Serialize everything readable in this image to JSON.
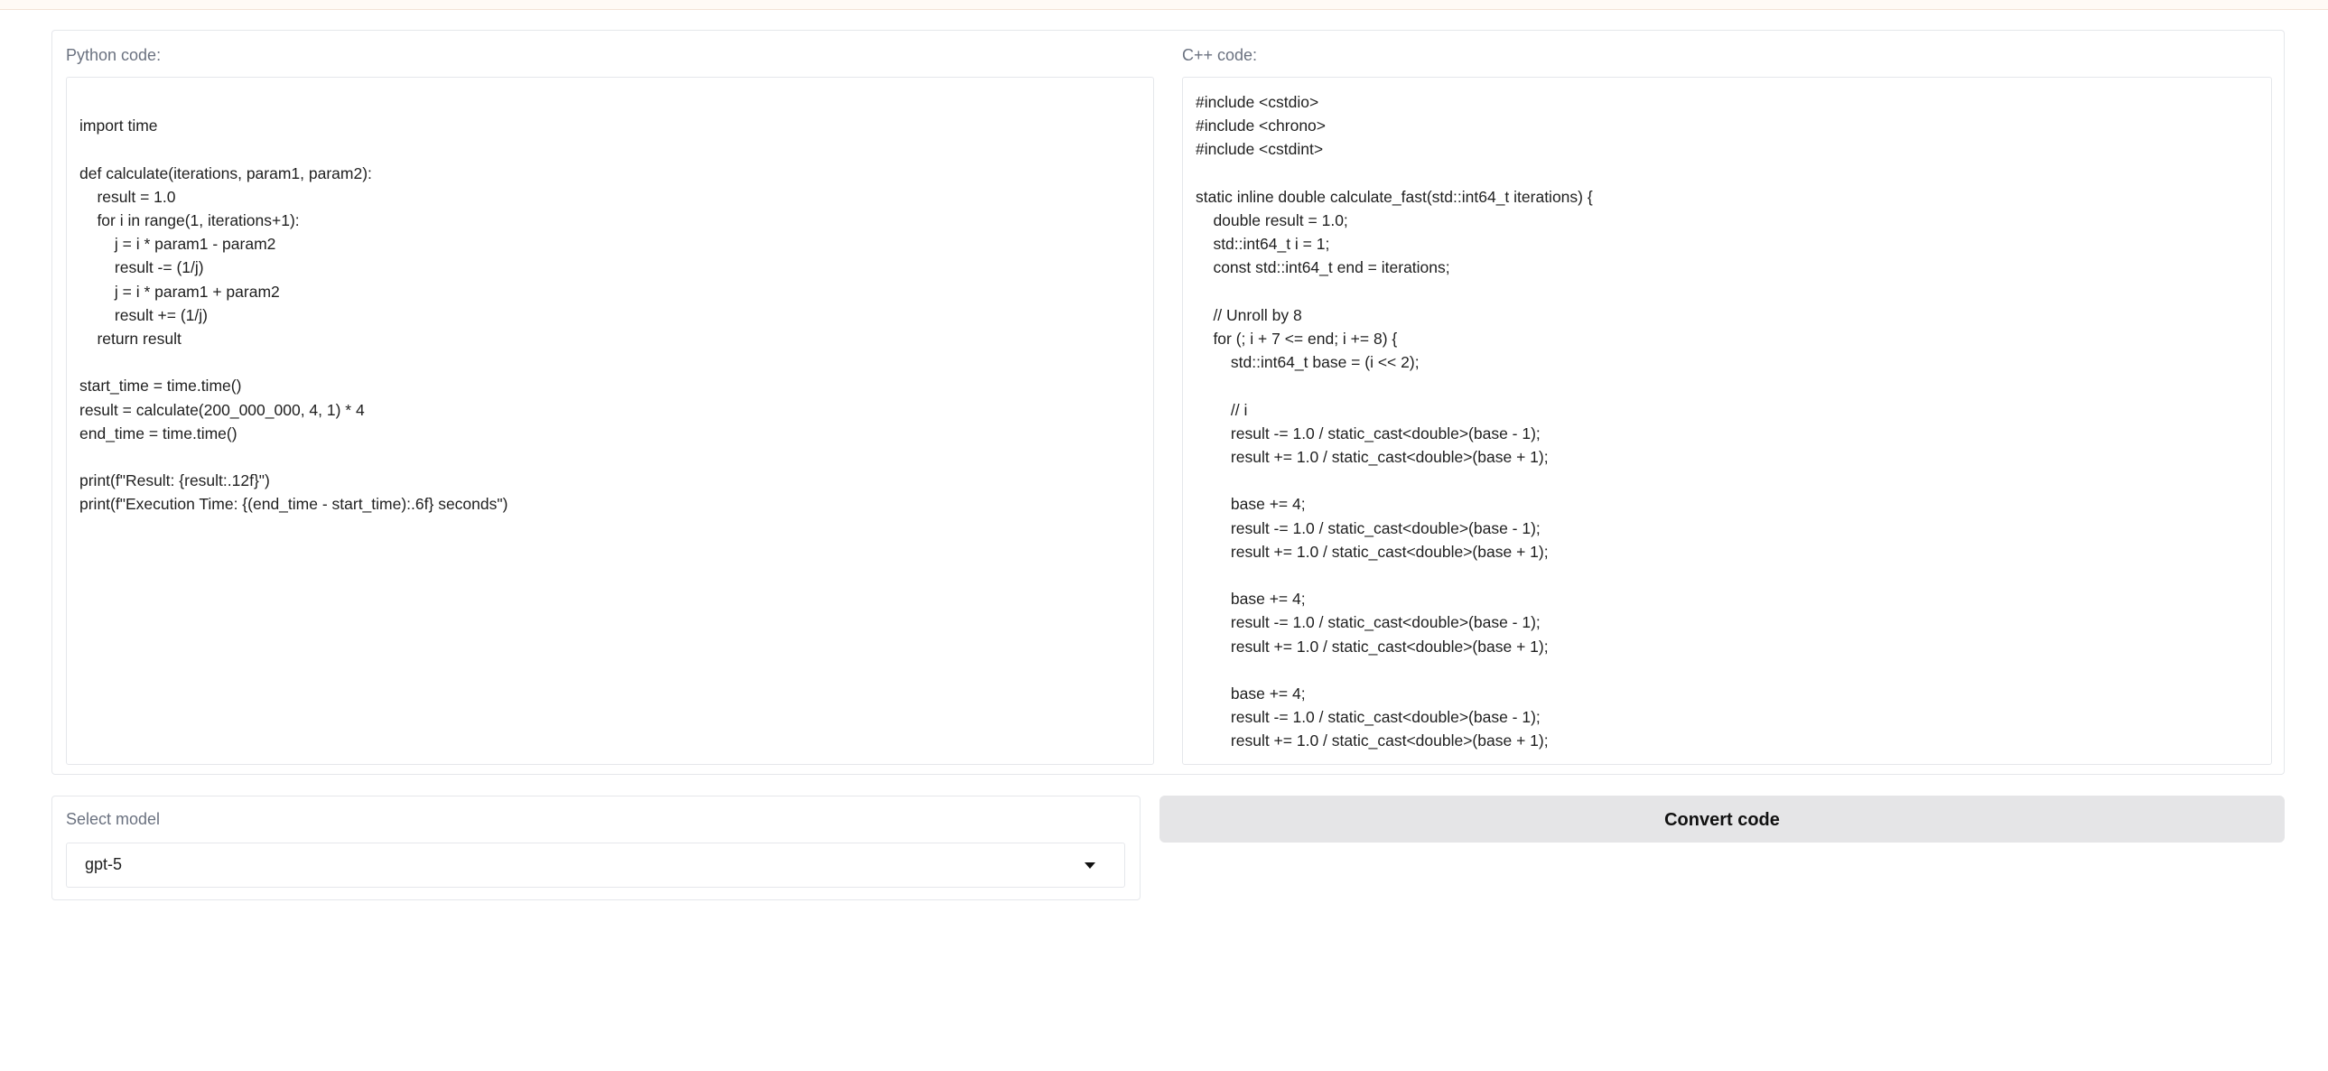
{
  "python": {
    "label": "Python code:",
    "code": "\nimport time\n\ndef calculate(iterations, param1, param2):\n    result = 1.0\n    for i in range(1, iterations+1):\n        j = i * param1 - param2\n        result -= (1/j)\n        j = i * param1 + param2\n        result += (1/j)\n    return result\n\nstart_time = time.time()\nresult = calculate(200_000_000, 4, 1) * 4\nend_time = time.time()\n\nprint(f\"Result: {result:.12f}\")\nprint(f\"Execution Time: {(end_time - start_time):.6f} seconds\")"
  },
  "cpp": {
    "label": "C++ code:",
    "code": "#include <cstdio>\n#include <chrono>\n#include <cstdint>\n\nstatic inline double calculate_fast(std::int64_t iterations) {\n    double result = 1.0;\n    std::int64_t i = 1;\n    const std::int64_t end = iterations;\n\n    // Unroll by 8\n    for (; i + 7 <= end; i += 8) {\n        std::int64_t base = (i << 2);\n\n        // i\n        result -= 1.0 / static_cast<double>(base - 1);\n        result += 1.0 / static_cast<double>(base + 1);\n\n        base += 4;\n        result -= 1.0 / static_cast<double>(base - 1);\n        result += 1.0 / static_cast<double>(base + 1);\n\n        base += 4;\n        result -= 1.0 / static_cast<double>(base - 1);\n        result += 1.0 / static_cast<double>(base + 1);\n\n        base += 4;\n        result -= 1.0 / static_cast<double>(base - 1);\n        result += 1.0 / static_cast<double>(base + 1);"
  },
  "model": {
    "label": "Select model",
    "selected": "gpt-5",
    "icon": "chevron-down-icon"
  },
  "convert": {
    "label": "Convert code"
  },
  "colors": {
    "button_bg": "#e5e5e7",
    "border": "#e5e7eb",
    "label_text": "#6b7280"
  }
}
